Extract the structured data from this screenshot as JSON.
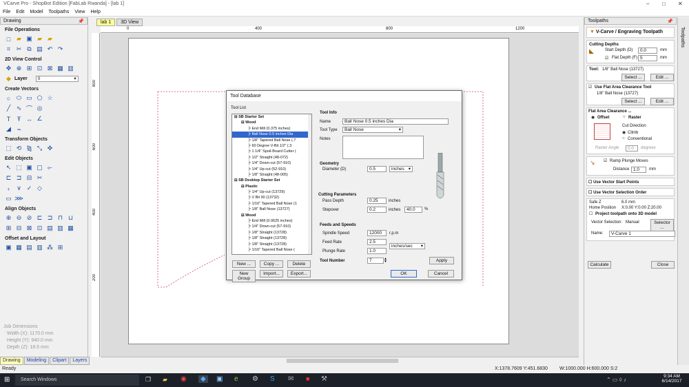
{
  "window": {
    "title": "VCarve Pro - ShopBot Edition [FabLab Rwanda] - [lab 1]",
    "min": "–",
    "max": "□",
    "close": "✕"
  },
  "menu": [
    "File",
    "Edit",
    "Model",
    "Toolpaths",
    "View",
    "Help"
  ],
  "left": {
    "header": "Drawing",
    "sections": [
      "File Operations",
      "2D View Control",
      "Create Vectors",
      "Transform Objects",
      "Edit Objects",
      "Align Objects",
      "Offset and Layout"
    ],
    "layer_label": "Layer",
    "layer_value": "0",
    "jobdims": [
      "Job Dimensions",
      "Width  (X): 1170.0 mm",
      "Height (Y): 940.0 mm",
      "Depth  (Z): 18.5 mm"
    ],
    "tabs": [
      "Drawing",
      "Modeling",
      "Clipart",
      "Layers"
    ]
  },
  "doc": {
    "tabs": [
      "lab 1",
      "3D View"
    ],
    "ruler_top": [
      "0",
      "400",
      "800",
      "1200"
    ],
    "ruler_left": [
      "800",
      "600",
      "400",
      "200"
    ]
  },
  "status": {
    "left": "Ready",
    "coords": "X:1378.7609 Y:451.6830",
    "dims": "W:1000.000  H:600.000  S:2"
  },
  "taskbar": {
    "search": "Search Windows",
    "time": "9:34 AM",
    "date": "6/14/2017"
  },
  "dialog": {
    "title": "Tool Database",
    "tool_list_label": "Tool List",
    "tree": [
      {
        "t": "SB Starter Set",
        "lvl": 0,
        "b": true
      },
      {
        "t": "Wood",
        "lvl": 1,
        "b": true
      },
      {
        "t": "End Mill (0.375 inches)",
        "lvl": 2
      },
      {
        "t": "Ball Nose 0.5 inches Dia",
        "lvl": 2,
        "sel": true
      },
      {
        "t": "1/8\" Tapered Ball Nose (.7",
        "lvl": 2
      },
      {
        "t": "60 Degree V-Bit  1/2\"  (.3",
        "lvl": 2
      },
      {
        "t": "1 1/4\" Spoil-Board Cutter (",
        "lvl": 2
      },
      {
        "t": "1/2\" Straight  (48-072)",
        "lvl": 2
      },
      {
        "t": "1/4\" Down-cut (57-910)",
        "lvl": 2
      },
      {
        "t": "1/4\" Up-cut (52-910)",
        "lvl": 2
      },
      {
        "t": "1/8\" Straight  (48-005)",
        "lvl": 2
      },
      {
        "t": "SB Desktop Starter Set",
        "lvl": 0,
        "b": true
      },
      {
        "t": "Plastic",
        "lvl": 1,
        "b": true
      },
      {
        "t": "1/4\" Up-cut (13729)",
        "lvl": 2
      },
      {
        "t": "V Bit 90 (13732)",
        "lvl": 2
      },
      {
        "t": "1/16\" Tapered Ball Nose (1",
        "lvl": 2
      },
      {
        "t": "1/8\" Ball Nose (13727)",
        "lvl": 2
      },
      {
        "t": "Wood",
        "lvl": 1,
        "b": true
      },
      {
        "t": "End Mill (0.0625 inches)",
        "lvl": 2
      },
      {
        "t": "1/4\" Down-cut (57-910)",
        "lvl": 2
      },
      {
        "t": "1/8\" Straight (13728)",
        "lvl": 2
      },
      {
        "t": "1/8\" Straight (13728)",
        "lvl": 2
      },
      {
        "t": "1/8\" Straight (13728)",
        "lvl": 2
      },
      {
        "t": "1/16\" Tapered Ball Nose (",
        "lvl": 2
      }
    ],
    "buttons": {
      "new": "New ...",
      "copy": "Copy ...",
      "delete": "Delete",
      "newgroup": "New Group",
      "import": "Import...",
      "export": "Export...",
      "apply": "Apply",
      "ok": "OK",
      "cancel": "Cancel"
    },
    "info": {
      "section": "Tool Info",
      "name_label": "Name",
      "name": "Ball Nose 0.5 inches Dia",
      "type_label": "Tool Type",
      "type": "Ball Nose",
      "notes_label": "Notes"
    },
    "geometry": {
      "section": "Geometry",
      "diam_label": "Diameter (D)",
      "diam": "0.5",
      "unit": "inches"
    },
    "cutting": {
      "section": "Cutting Parameters",
      "pass_label": "Pass Depth",
      "pass": "0.25",
      "pass_unit": "inches",
      "step_label": "Stepover",
      "step": "0.2",
      "step_unit": "inches",
      "pct": "40.0",
      "pct_sign": "%"
    },
    "feeds": {
      "section": "Feeds and Speeds",
      "spindle_label": "Spindle Speed",
      "spindle": "12000",
      "spindle_unit": "r.p.m",
      "feed_label": "Feed Rate",
      "feed": "2.5",
      "feed_unit": "inches/sec",
      "plunge_label": "Plunge Rate",
      "plunge": "1.0",
      "toolnum_label": "Tool Number",
      "toolnum": "7"
    }
  },
  "right": {
    "header": "Toolpaths",
    "vtab": "Toolpaths",
    "title": "V-Carve / Engraving Toolpath",
    "cd": {
      "label": "Cutting Depths",
      "start_label": "Start Depth (D)",
      "start": "0.0",
      "flat_label": "Flat Depth (F)",
      "flat": "5",
      "unit": "mm"
    },
    "tool": {
      "label": "Tool:",
      "name": "1/8\" Ball Nose (13727)",
      "select": "Select ...",
      "edit": "Edit ..."
    },
    "flat_tool": {
      "label": "Use Flat Area Clearance Tool",
      "name": "1/8\" Ball Nose (13727)",
      "select": "Select ...",
      "edit": "Edit ..."
    },
    "fac": {
      "label": "Flat Area Clearance ...",
      "offset": "Offset",
      "raster": "Raster",
      "cutdir": "Cut Direction",
      "climb": "Climb",
      "conv": "Conventional",
      "angle_label": "Raster Angle",
      "angle": "0.0",
      "angle_unit": "degrees"
    },
    "ramp": {
      "label": "Ramp Plunge Moves",
      "dist_label": "Distance",
      "dist": "1.0",
      "unit": "mm"
    },
    "vsm": "Use Vector Start Points",
    "vso": "Use Vector Selection Order",
    "safe": {
      "z_label": "Safe Z",
      "z": "6.0 mm",
      "home_label": "Home Position",
      "home": "X:0.00 Y:0.00 Z:20.00",
      "project": "Project toolpath onto 3D model"
    },
    "vsel": {
      "label": "Vector Selection:",
      "value": "Manual",
      "btn": "Selector ..."
    },
    "name": {
      "label": "Name:",
      "value": "V-Carve 1"
    },
    "calc": "Calculate",
    "close": "Close"
  }
}
